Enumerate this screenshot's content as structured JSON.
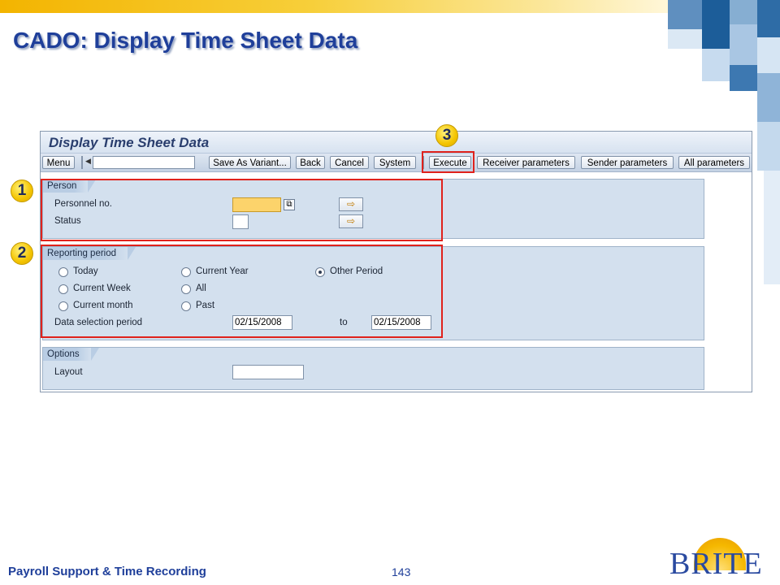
{
  "slide": {
    "title": "CADO: Display Time Sheet Data",
    "footer_left": "Payroll Support & Time Recording",
    "page_number": "143",
    "logo_text": "BRITE"
  },
  "window": {
    "title": "Display Time Sheet Data"
  },
  "toolbar": {
    "menu": "Menu",
    "save_as_variant": "Save As Variant...",
    "back": "Back",
    "cancel": "Cancel",
    "system": "System",
    "execute": "Execute",
    "receiver_parameters": "Receiver parameters",
    "sender_parameters": "Sender parameters",
    "all_parameters": "All parameters"
  },
  "person": {
    "heading": "Person",
    "personnel_no_label": "Personnel no.",
    "personnel_no_value": "",
    "status_label": "Status",
    "status_value": ""
  },
  "reporting": {
    "heading": "Reporting period",
    "options": {
      "today": "Today",
      "current_week": "Current Week",
      "current_month": "Current month",
      "current_year": "Current Year",
      "all": "All",
      "past": "Past",
      "other_period": "Other Period"
    },
    "selected": "Other Period",
    "data_selection_label": "Data selection period",
    "from_date": "02/15/2008",
    "to_label": "to",
    "to_date": "02/15/2008"
  },
  "options_group": {
    "heading": "Options",
    "layout_label": "Layout",
    "layout_value": ""
  },
  "callouts": {
    "one": "1",
    "two": "2",
    "three": "3"
  },
  "colors": {
    "title": "#1f3f9a",
    "callout_border": "#e0221c",
    "badge": "#f4c400",
    "group_bg": "#d3e0ee",
    "required_field": "#fcd36b"
  }
}
